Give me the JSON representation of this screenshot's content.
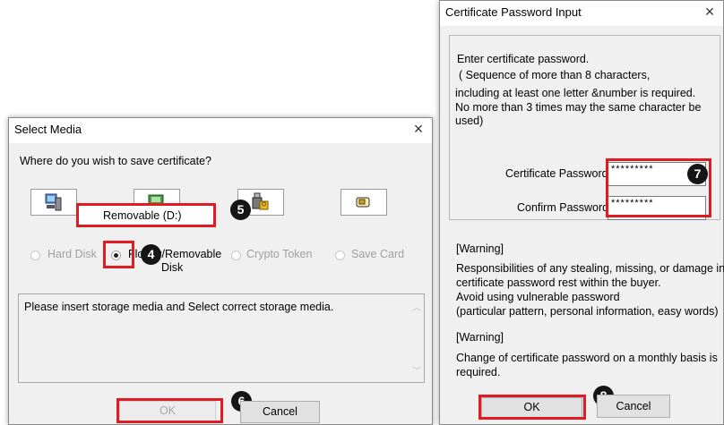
{
  "select_media": {
    "title": "Select Media",
    "close": "×",
    "question": "Where do you wish to save certificate?",
    "tooltip": "Removable (D:)",
    "options": {
      "hard_disk": "Hard Disk",
      "floppy_line1": "Floppy/Removable",
      "floppy_line2": "Disk",
      "crypto": "Crypto Token",
      "save_card": "Save Card"
    },
    "message": "Please insert storage media and Select correct storage media.",
    "ok": "OK",
    "cancel": "Cancel"
  },
  "cert_password": {
    "title": "Certificate Password Input",
    "close": "×",
    "intro": [
      "Enter certificate password.",
      "( Sequence of more than 8 characters,",
      " including at   least one letter &number is required.",
      "No more than  3 times may the same character be",
      "used)"
    ],
    "password_label": "Certificate Password",
    "password_value": "*********",
    "confirm_label": "Confirm Password",
    "confirm_value": "*********",
    "warning1_title": "[Warning]",
    "warning1_lines": [
      "Responsibilities of  any stealing, missing, or damage in",
      "certificate password rest within the buyer.",
      "Avoid using vulnerable password",
      "(particular pattern, personal information, easy words)"
    ],
    "warning2_title": "[Warning]",
    "warning2_lines": [
      "Change of certificate password on a monthly basis is",
      "required."
    ],
    "ok": "OK",
    "cancel": "Cancel"
  },
  "badges": [
    "4",
    "5",
    "6",
    "7",
    "8"
  ],
  "colors": {
    "highlight": "#e01b22",
    "badge": "#151515",
    "dialog_bg": "#f0f0f0"
  }
}
